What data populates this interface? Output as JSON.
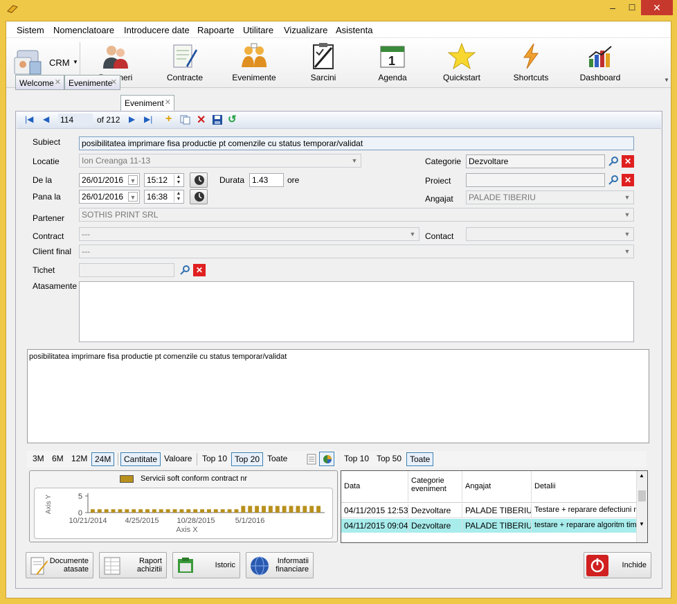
{
  "menu": [
    "Sistem",
    "Nomenclatoare",
    "Introducere date",
    "Rapoarte",
    "Utilitare",
    "Vizualizare",
    "Asistenta"
  ],
  "toolbar": {
    "crm_label": "CRM",
    "buttons": [
      "Parteneri",
      "Contracte",
      "Evenimente",
      "Sarcini",
      "Agenda",
      "Quickstart",
      "Shortcuts",
      "Dashboard"
    ]
  },
  "tabs": [
    "Welcome",
    "Evenimente",
    "Eveniment"
  ],
  "nav": {
    "record": "114",
    "of": "of 212"
  },
  "form": {
    "subiect_label": "Subiect",
    "subiect": "posibilitatea imprimare fisa productie pt comenzile cu status temporar/validat",
    "locatie_label": "Locatie",
    "locatie": "Ion Creanga 11-13",
    "dela_label": "De la",
    "dela_date": "26/01/2016",
    "dela_time": "15:12",
    "panala_label": "Pana la",
    "panala_date": "26/01/2016",
    "panala_time": "16:38",
    "durata_label": "Durata",
    "durata": "1.43",
    "ore_label": "ore",
    "categorie_label": "Categorie",
    "categorie": "Dezvoltare",
    "proiect_label": "Proiect",
    "proiect": "",
    "angajat_label": "Angajat",
    "angajat": "PALADE TIBERIU",
    "partener_label": "Partener",
    "partener": "SOTHIS PRINT SRL",
    "contract_label": "Contract",
    "contract": "---",
    "contact_label": "Contact",
    "contact": "",
    "clientfinal_label": "Client final",
    "clientfinal": "---",
    "tichet_label": "Tichet",
    "tichet": "",
    "atasamente_label": "Atasamente",
    "descriere": "posibilitatea imprimare fisa productie pt comenzile cu status temporar/validat"
  },
  "chart_controls": [
    "3M",
    "6M",
    "12M",
    "24M",
    "Cantitate",
    "Valoare",
    "Top 10",
    "Top 20",
    "Toate"
  ],
  "chart_controls_selected": [
    "24M",
    "Cantitate",
    "Top 20"
  ],
  "chart_data": {
    "type": "bar",
    "title": "",
    "series": [
      {
        "name": "Servicii soft conform contract nr",
        "color": "#b8901c",
        "values": [
          1,
          1,
          1,
          1,
          1,
          1,
          1,
          1,
          1,
          1,
          1,
          1,
          1,
          1,
          1,
          1,
          1,
          1,
          1,
          1,
          1,
          1,
          2,
          2,
          2,
          2,
          2,
          2,
          2,
          2,
          2,
          2,
          2,
          2
        ]
      }
    ],
    "x_tick_labels": [
      "10/21/2014",
      "4/25/2015",
      "10/28/2015",
      "5/1/2016"
    ],
    "xlabel": "Axis X",
    "ylabel": "Axis Y",
    "y_ticks": [
      "5",
      "0"
    ],
    "ylim": [
      0,
      5
    ]
  },
  "grid_controls": [
    "Top 10",
    "Top 50",
    "Toate"
  ],
  "grid_controls_selected": "Toate",
  "grid": {
    "headers": [
      "Data",
      "Categorie eveniment",
      "Angajat",
      "Detalii"
    ],
    "rows": [
      [
        "04/11/2015 12:53",
        "Dezvoltare",
        "PALADE TIBERIU",
        "Testare + reparare defectiuni m"
      ],
      [
        "04/11/2015 09:04",
        "Dezvoltare",
        "PALADE TIBERIU",
        "testare + reparare algoritm timp"
      ]
    ]
  },
  "bottom_buttons": {
    "documente": "Documente atasate",
    "raport": "Raport achizitii",
    "istoric": "Istoric",
    "informatii": "Informatii financiare",
    "inchide": "Inchide"
  }
}
